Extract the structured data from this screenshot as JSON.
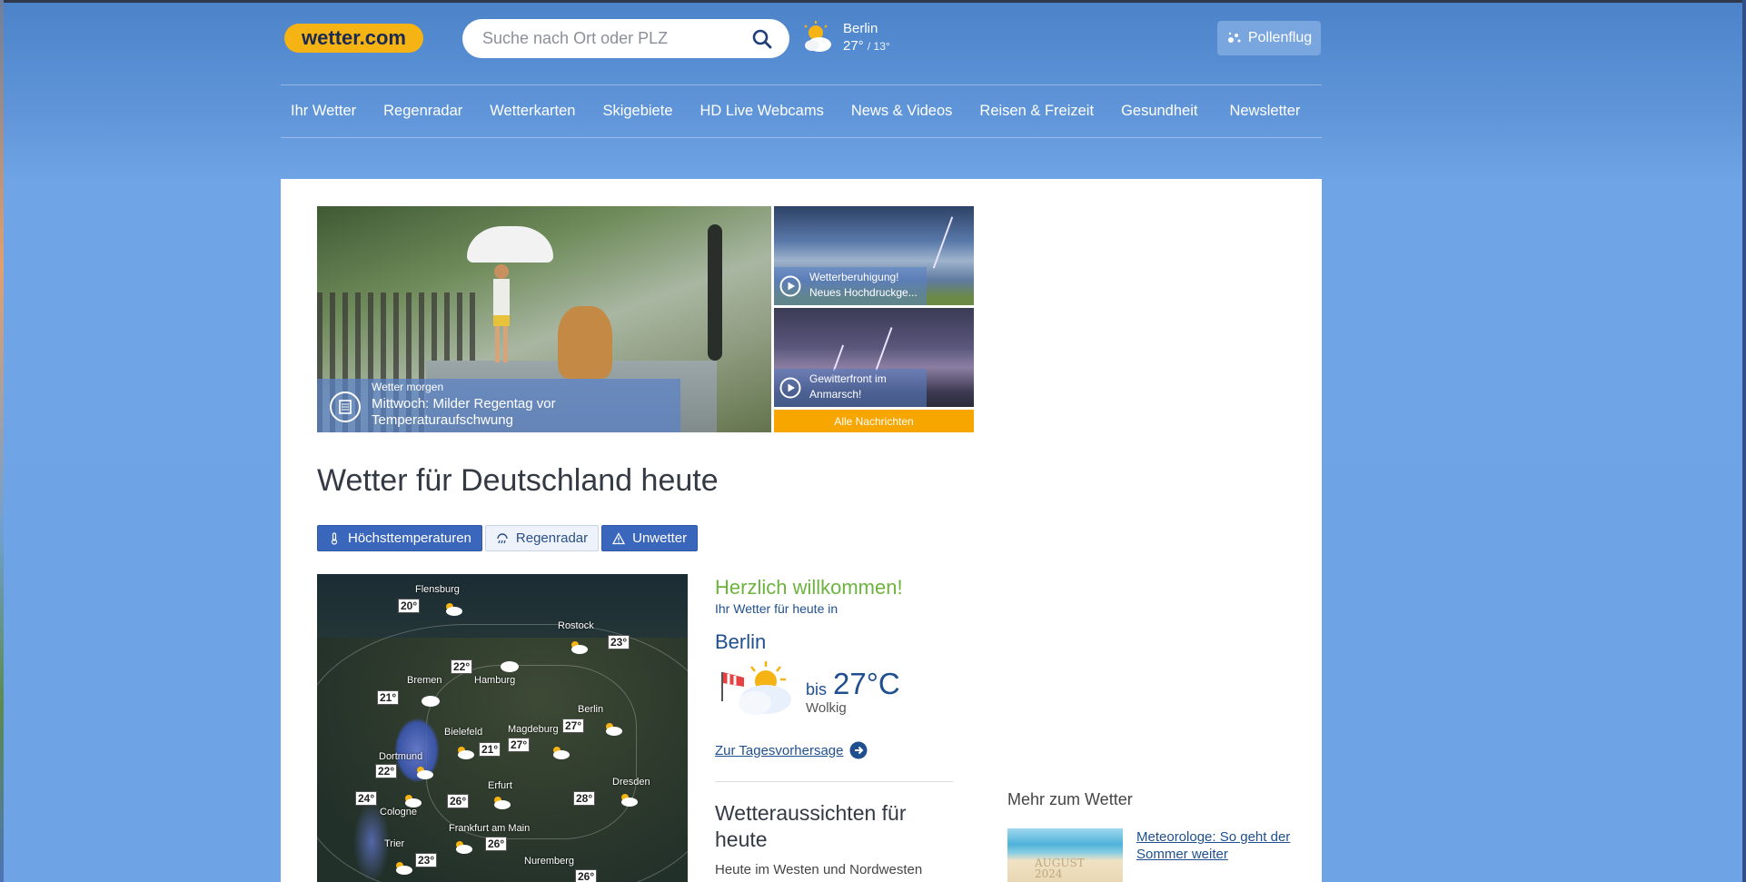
{
  "header": {
    "logo": "wetter.com",
    "search_placeholder": "Suche nach Ort oder PLZ",
    "location": {
      "city": "Berlin",
      "high": "27°",
      "low": "/ 13°"
    },
    "pollen_label": "Pollenflug"
  },
  "nav": [
    {
      "label": "Ihr Wetter"
    },
    {
      "label": "Regenradar"
    },
    {
      "label": "Wetterkarten"
    },
    {
      "label": "Skigebiete"
    },
    {
      "label": "HD Live Webcams"
    },
    {
      "label": "News & Videos"
    },
    {
      "label": "Reisen & Freizeit"
    },
    {
      "label": "Gesundheit"
    },
    {
      "label": "Newsletter"
    }
  ],
  "hero": {
    "kicker": "Wetter morgen",
    "headline": "Mittwoch: Milder Regentag vor Temperaturaufschwung"
  },
  "tiles": [
    {
      "caption": "Wetterberuhigung! Neues Hochdruckge..."
    },
    {
      "caption": "Gewitterfront im Anmarsch!"
    }
  ],
  "all_news_label": "Alle Nachrichten",
  "page_title": "Wetter für Deutschland heute",
  "tabs": [
    {
      "label": "Höchsttemperaturen",
      "icon": "thermometer-icon"
    },
    {
      "label": "Regenradar",
      "icon": "rain-radar-icon"
    },
    {
      "label": "Unwetter",
      "icon": "warning-icon"
    }
  ],
  "map": {
    "cities": [
      {
        "name": "Flensburg",
        "temp": "20°"
      },
      {
        "name": "Rostock",
        "temp": "23°"
      },
      {
        "name": "Hamburg",
        "temp": "22°"
      },
      {
        "name": "Bremen",
        "temp": "21°"
      },
      {
        "name": "Berlin",
        "temp": "27°"
      },
      {
        "name": "Bielefeld",
        "temp": "21°"
      },
      {
        "name": "Magdeburg",
        "temp": "27°"
      },
      {
        "name": "Dortmund",
        "temp": "22°"
      },
      {
        "name": "Dresden",
        "temp": "28°"
      },
      {
        "name": "Erfurt",
        "temp": "26°"
      },
      {
        "name": "Cologne",
        "temp": "24°"
      },
      {
        "name": "Frankfurt am Main",
        "temp": "26°"
      },
      {
        "name": "Trier",
        "temp": "23°"
      },
      {
        "name": "Nuremberg",
        "temp": "26°"
      }
    ]
  },
  "welcome": {
    "greeting": "Herzlich willkommen!",
    "subtitle": "Ihr Wetter für heute in",
    "city": "Berlin",
    "bis": "bis",
    "temperature": "27°C",
    "condition": "Wolkig",
    "forecast_link": "Zur Tagesvorhersage"
  },
  "outlook": {
    "title": "Wetteraussichten für heute",
    "text": "Heute im Westen und Nordwesten"
  },
  "more": {
    "title": "Mehr zum Wetter",
    "article_title": "Meteorologe: So geht der Sommer weiter",
    "image_text": "AUGUST 2024"
  },
  "colors": {
    "accent": "#f6b314",
    "primary_blue": "#3a66bb",
    "link_blue": "#1f4f8f",
    "green": "#6db33f",
    "orange": "#f7a600"
  }
}
